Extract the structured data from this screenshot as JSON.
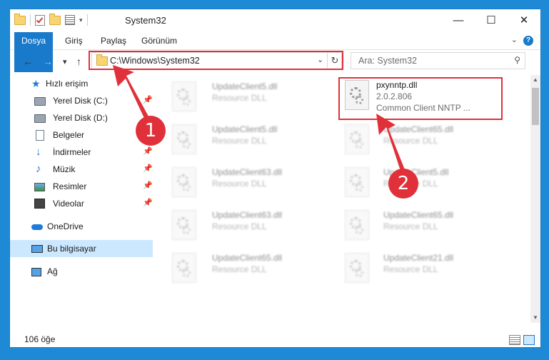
{
  "window": {
    "title": "System32",
    "controls": {
      "minimize": "—",
      "maximize": "☐",
      "close": "✕"
    }
  },
  "ribbon": {
    "tabs": [
      "Dosya",
      "Giriş",
      "Paylaş",
      "Görünüm"
    ],
    "accent_color": "#1979ca"
  },
  "navigation": {
    "back": "←",
    "forward": "→",
    "recent": "▾",
    "up": "↑",
    "address": "C:\\Windows\\System32",
    "search_placeholder": "Ara: System32"
  },
  "sidebar": {
    "items": [
      {
        "label": "Hızlı erişim",
        "icon": "star-icon"
      },
      {
        "label": "Yerel Disk (C:)",
        "icon": "drive-icon",
        "pinned": true
      },
      {
        "label": "Yerel Disk (D:)",
        "icon": "drive-icon",
        "pinned": false
      },
      {
        "label": "Belgeler",
        "icon": "documents-icon",
        "pinned": false
      },
      {
        "label": "İndirmeler",
        "icon": "download-icon",
        "pinned": true
      },
      {
        "label": "Müzik",
        "icon": "music-icon",
        "pinned": true
      },
      {
        "label": "Resimler",
        "icon": "pictures-icon",
        "pinned": true
      },
      {
        "label": "Videolar",
        "icon": "videos-icon",
        "pinned": true
      },
      {
        "label": "OneDrive",
        "icon": "cloud-icon"
      },
      {
        "label": "Bu bilgisayar",
        "icon": "computer-icon",
        "selected": true
      },
      {
        "label": "Ağ",
        "icon": "network-icon"
      }
    ]
  },
  "files": {
    "left_column": [
      {
        "name": "UpdateClient5.dll",
        "type": "Resource DLL"
      },
      {
        "name": "UpdateClient5.dll",
        "type": "Resource DLL"
      },
      {
        "name": "UpdateClient63.dll",
        "type": "Resource DLL"
      },
      {
        "name": "UpdateClient63.dll",
        "type": "Resource DLL"
      },
      {
        "name": "UpdateClient65.dll",
        "type": "Resource DLL"
      }
    ],
    "highlighted": {
      "name": "pxynntp.dll",
      "version": "2.0.2.806",
      "description": "Common Client NNTP ..."
    },
    "right_column": [
      {
        "name": "UpdateClient65.dll",
        "type": "Resource DLL"
      },
      {
        "name": "UpdateClient5.dll",
        "type": "Resource DLL"
      },
      {
        "name": "UpdateClient65.dll",
        "type": "Resource DLL"
      },
      {
        "name": "UpdateClient21.dll",
        "type": "Resource DLL"
      }
    ]
  },
  "status": {
    "item_count": "106 öğe"
  },
  "annotations": {
    "step1": "1",
    "step2": "2",
    "highlight_color": "#e0303a"
  }
}
